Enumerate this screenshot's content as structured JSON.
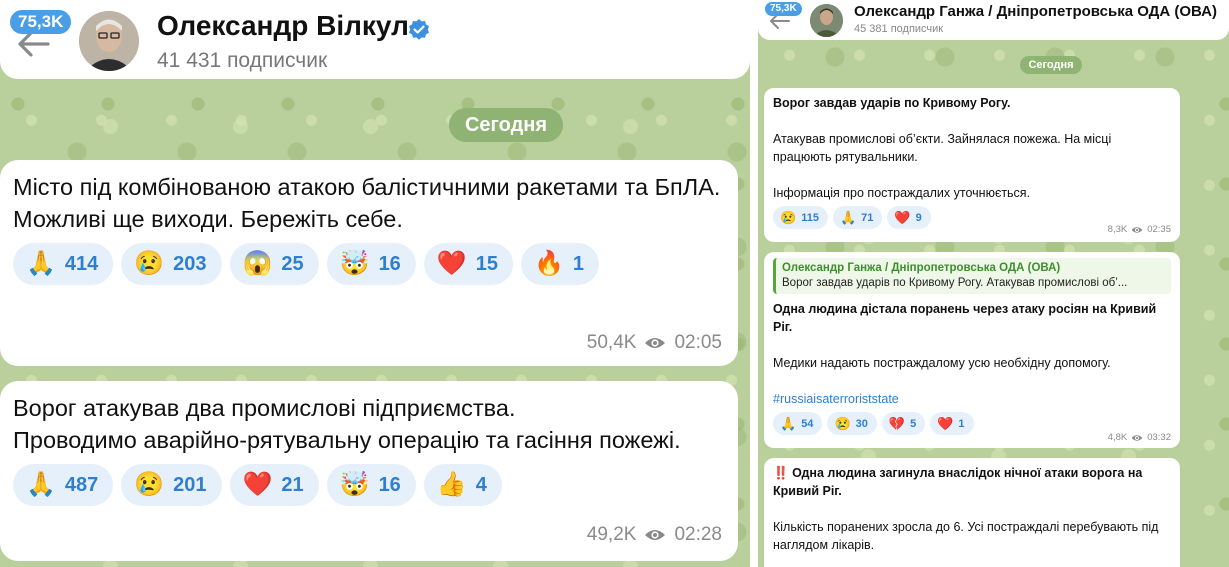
{
  "left": {
    "badge": "75,3K",
    "channel_name": "Олександр Вілкул",
    "subscribers": "41 431 подписчик",
    "date_chip": "Сегодня",
    "messages": [
      {
        "text": "Місто під комбінованою атакою балістичними ракетами та БпЛА.\nМожливі ще виходи. Бережіть себе.",
        "reactions": [
          {
            "emoji": "🙏",
            "icon": "folded-hands-icon",
            "count": "414"
          },
          {
            "emoji": "😢",
            "icon": "crying-face-icon",
            "count": "203"
          },
          {
            "emoji": "😱",
            "icon": "screaming-face-icon",
            "count": "25"
          },
          {
            "emoji": "🤯",
            "icon": "exploding-head-icon",
            "count": "16"
          },
          {
            "emoji": "❤️",
            "icon": "heart-icon",
            "count": "15"
          },
          {
            "emoji": "🔥",
            "icon": "fire-icon",
            "count": "1"
          }
        ],
        "views": "50,4K",
        "time": "02:05"
      },
      {
        "text": "Ворог атакував два промислові підприємства.\nПроводимо аварійно-рятувальну операцію та гасіння пожежі.",
        "reactions": [
          {
            "emoji": "🙏",
            "icon": "folded-hands-icon",
            "count": "487"
          },
          {
            "emoji": "😢",
            "icon": "crying-face-icon",
            "count": "201"
          },
          {
            "emoji": "❤️",
            "icon": "heart-icon",
            "count": "21"
          },
          {
            "emoji": "🤯",
            "icon": "exploding-head-icon",
            "count": "16"
          },
          {
            "emoji": "👍",
            "icon": "thumbs-up-icon",
            "count": "4"
          }
        ],
        "views": "49,2K",
        "time": "02:28"
      }
    ]
  },
  "right": {
    "badge": "75,3K",
    "channel_name": "Олександр Ганжа / Дніпропетровська ОДА (ОВА)",
    "subscribers": "45 381 подписчик",
    "date_chip": "Сегодня",
    "messages": [
      {
        "title": "Ворог завдав ударів по Кривому Рогу.",
        "p1": "Атакував промислові об’єкти. Зайнялася  пожежа. На місці працюють рятувальники.",
        "p2": "Інформація про постраждалих уточнюється.",
        "reactions": [
          {
            "emoji": "😢",
            "icon": "crying-face-icon",
            "count": "115"
          },
          {
            "emoji": "🙏",
            "icon": "folded-hands-icon",
            "count": "71"
          },
          {
            "emoji": "❤️",
            "icon": "heart-icon",
            "count": "9"
          }
        ],
        "views": "8,3K",
        "time": "02:35"
      },
      {
        "quote_title": "Олександр Ганжа / Дніпропетровська ОДА (ОВА)",
        "quote_text": "Ворог завдав ударів по Кривому Рогу. Атакував промислові об’...",
        "title": "Одна людина дістала поранень через атаку росіян на Кривий Ріг.",
        "p1": "Медики надають постраждалому усю необхідну допомогу.",
        "hashtag": "#russiaisaterroriststate",
        "reactions": [
          {
            "emoji": "🙏",
            "icon": "folded-hands-icon",
            "count": "54"
          },
          {
            "emoji": "😢",
            "icon": "crying-face-icon",
            "count": "30"
          },
          {
            "emoji": "💔",
            "icon": "broken-heart-icon",
            "count": "5"
          },
          {
            "emoji": "❤️",
            "icon": "heart-icon",
            "count": "1"
          }
        ],
        "views": "4,8K",
        "time": "03:32"
      },
      {
        "prefix": "‼️",
        "title": "Одна людина загинула внаслідок нічної атаки ворога на Кривий Ріг.",
        "p1": "Кількість поранених зросла до 6. Усі постраждалі перебувають під наглядом лікарів."
      }
    ]
  }
}
